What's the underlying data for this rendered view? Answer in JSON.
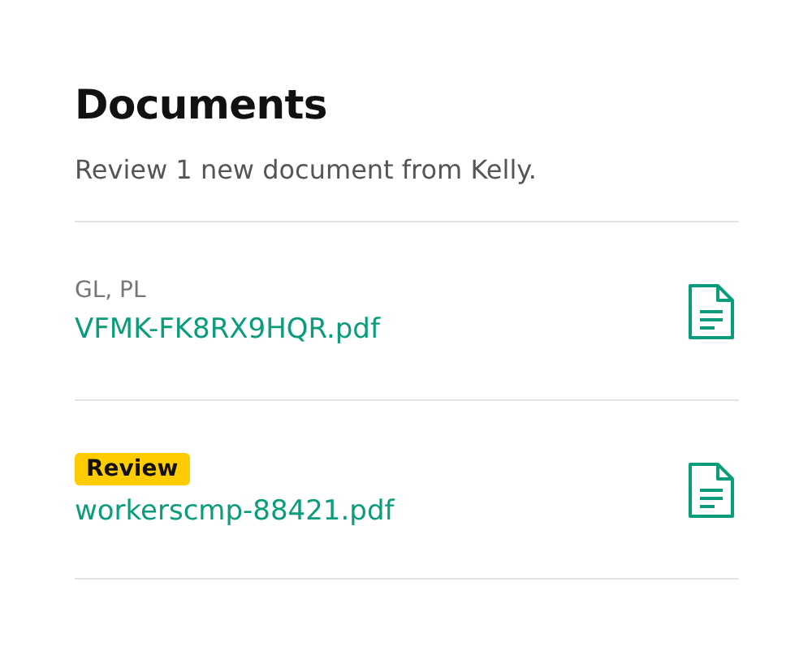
{
  "title": "Documents",
  "subtitle": "Review 1 new document from Kelly.",
  "documents": [
    {
      "kind": "tags",
      "label": "GL, PL",
      "file": "VFMK-FK8RX9HQR.pdf"
    },
    {
      "kind": "badge",
      "label": "Review",
      "file": "workerscmp-88421.pdf"
    }
  ]
}
